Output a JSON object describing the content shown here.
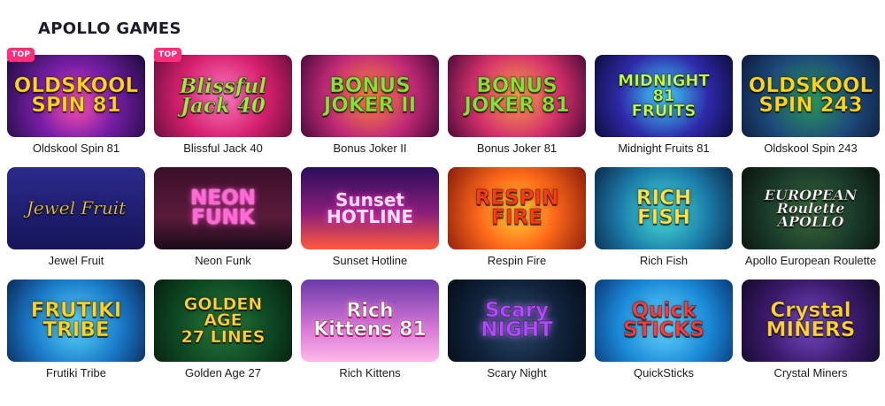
{
  "section": {
    "title": "APOLLO GAMES"
  },
  "games": [
    {
      "name": "Oldskool Spin 81",
      "badge": "TOP",
      "logo": "OLDSKOOL\nSPIN 81"
    },
    {
      "name": "Blissful Jack 40",
      "badge": "TOP",
      "logo": "Blissful\nJack 40"
    },
    {
      "name": "Bonus Joker II",
      "badge": "",
      "logo": "BONUS\nJOKER II"
    },
    {
      "name": "Bonus Joker 81",
      "badge": "",
      "logo": "BONUS\nJOKER 81"
    },
    {
      "name": "Midnight Fruits 81",
      "badge": "",
      "logo": "MIDNIGHT\n81\nFRUITS"
    },
    {
      "name": "Oldskool Spin 243",
      "badge": "",
      "logo": "OLDSKOOL\nSPIN 243"
    },
    {
      "name": "Jewel Fruit",
      "badge": "",
      "logo": "Jewel Fruit"
    },
    {
      "name": "Neon Funk",
      "badge": "",
      "logo": "NEON\nFUNK"
    },
    {
      "name": "Sunset Hotline",
      "badge": "",
      "logo": "Sunset\nHOTLINE"
    },
    {
      "name": "Respin Fire",
      "badge": "",
      "logo": "RESPIN\nFIRE"
    },
    {
      "name": "Rich Fish",
      "badge": "",
      "logo": "RICH\nFISH"
    },
    {
      "name": "Apollo European Roulette",
      "badge": "",
      "logo": "EUROPEAN\nRoulette\nAPOLLO"
    },
    {
      "name": "Frutiki Tribe",
      "badge": "",
      "logo": "FRUTIKI\nTRIBE"
    },
    {
      "name": "Golden Age 27",
      "badge": "",
      "logo": "GOLDEN\nAGE\n27 LINES"
    },
    {
      "name": "Rich Kittens",
      "badge": "",
      "logo": "Rich\nKittens 81"
    },
    {
      "name": "Scary Night",
      "badge": "",
      "logo": "Scary\nNIGHT"
    },
    {
      "name": "QuickSticks",
      "badge": "",
      "logo": "Quick\nSTICKS"
    },
    {
      "name": "Crystal Miners",
      "badge": "",
      "logo": "Crystal\nMINERS"
    }
  ]
}
